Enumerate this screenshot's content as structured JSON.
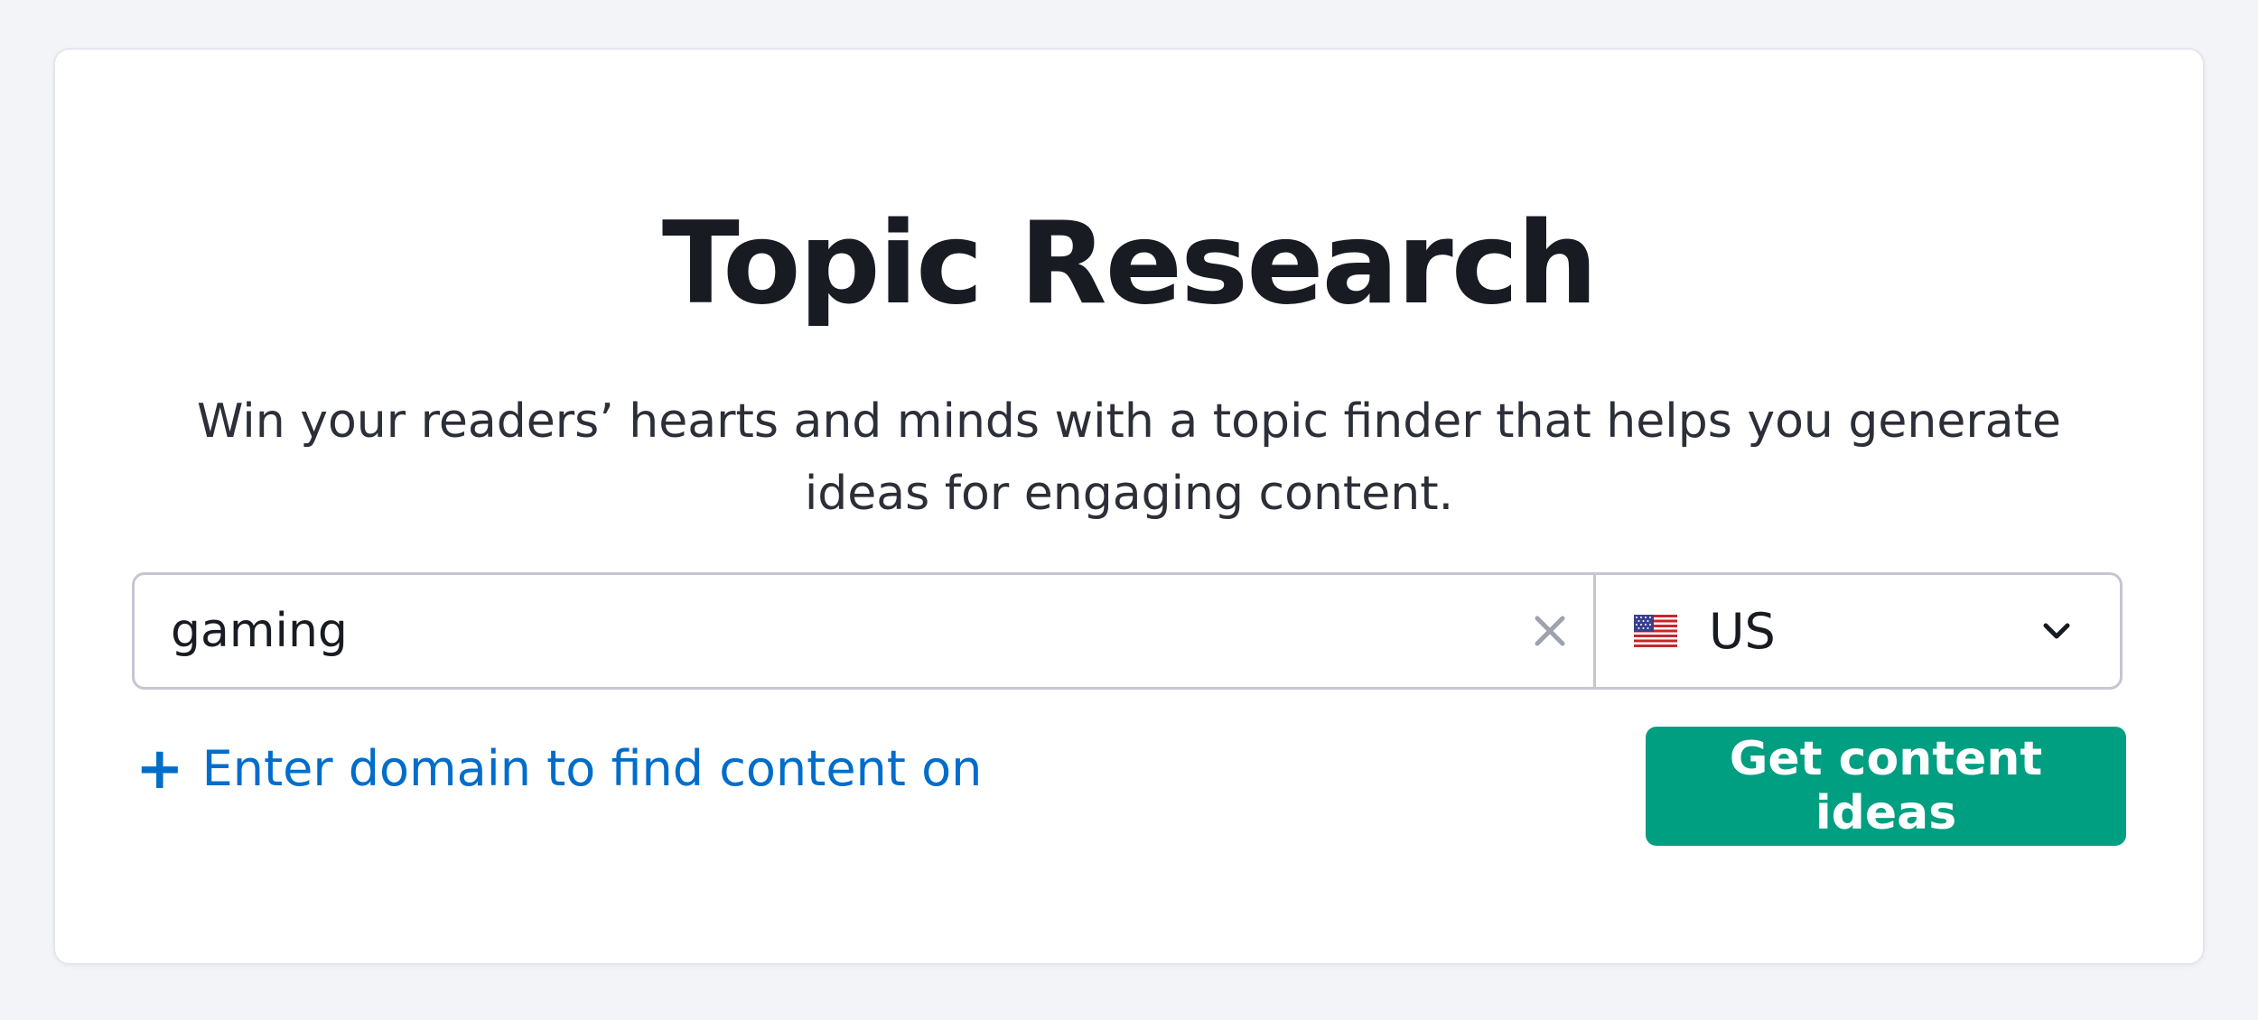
{
  "page": {
    "title": "Topic Research",
    "subtitle": "Win your readers’ hearts and minds with a topic finder that helps you generate ideas for engaging content."
  },
  "search": {
    "value": "gaming",
    "clear_icon": "close-icon"
  },
  "database": {
    "flag_icon": "us-flag-icon",
    "label": "US",
    "dropdown_icon": "chevron-down-icon"
  },
  "domain_link": {
    "icon": "plus-icon",
    "label": "Enter domain to find content on"
  },
  "cta": {
    "label": "Get content ideas"
  },
  "colors": {
    "background": "#f3f4f8",
    "card": "#ffffff",
    "title": "#191b23",
    "link": "#006dca",
    "primary_button": "#009f81",
    "border": "#c4c7d0"
  }
}
